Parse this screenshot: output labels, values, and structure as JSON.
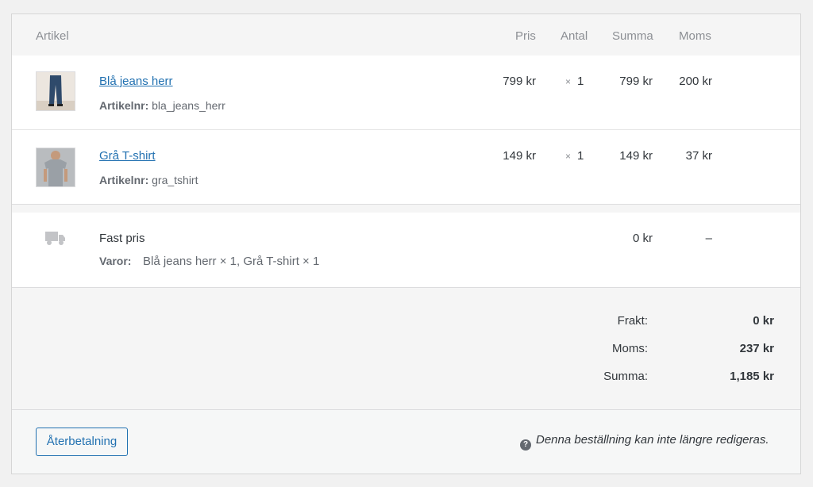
{
  "header": {
    "item": "Artikel",
    "price": "Pris",
    "qty": "Antal",
    "total": "Summa",
    "tax": "Moms"
  },
  "items": [
    {
      "name": "Blå jeans herr",
      "sku_label": "Artikelnr:",
      "sku": "bla_jeans_herr",
      "price": "799 kr",
      "qty_symbol": "×",
      "qty": "1",
      "total": "799 kr",
      "tax": "200 kr",
      "thumb_icon": "jeans-thumbnail"
    },
    {
      "name": "Grå T-shirt",
      "sku_label": "Artikelnr:",
      "sku": "gra_tshirt",
      "price": "149 kr",
      "qty_symbol": "×",
      "qty": "1",
      "total": "149 kr",
      "tax": "37 kr",
      "thumb_icon": "tshirt-thumbnail"
    }
  ],
  "shipping": {
    "icon": "truck-icon",
    "method": "Fast pris",
    "items_label": "Varor:",
    "items_value": "Blå jeans herr × 1, Grå T-shirt × 1",
    "total": "0 kr",
    "tax": "–"
  },
  "totals": {
    "shipping_label": "Frakt:",
    "shipping_value": "0 kr",
    "tax_label": "Moms:",
    "tax_value": "237 kr",
    "total_label": "Summa:",
    "total_value": "1,185 kr"
  },
  "footer": {
    "refund_button": "Återbetalning",
    "help_icon": "?",
    "notice": "Denna beställning kan inte längre redigeras."
  },
  "colors": {
    "link": "#2271b1",
    "muted": "#8c8f94"
  }
}
